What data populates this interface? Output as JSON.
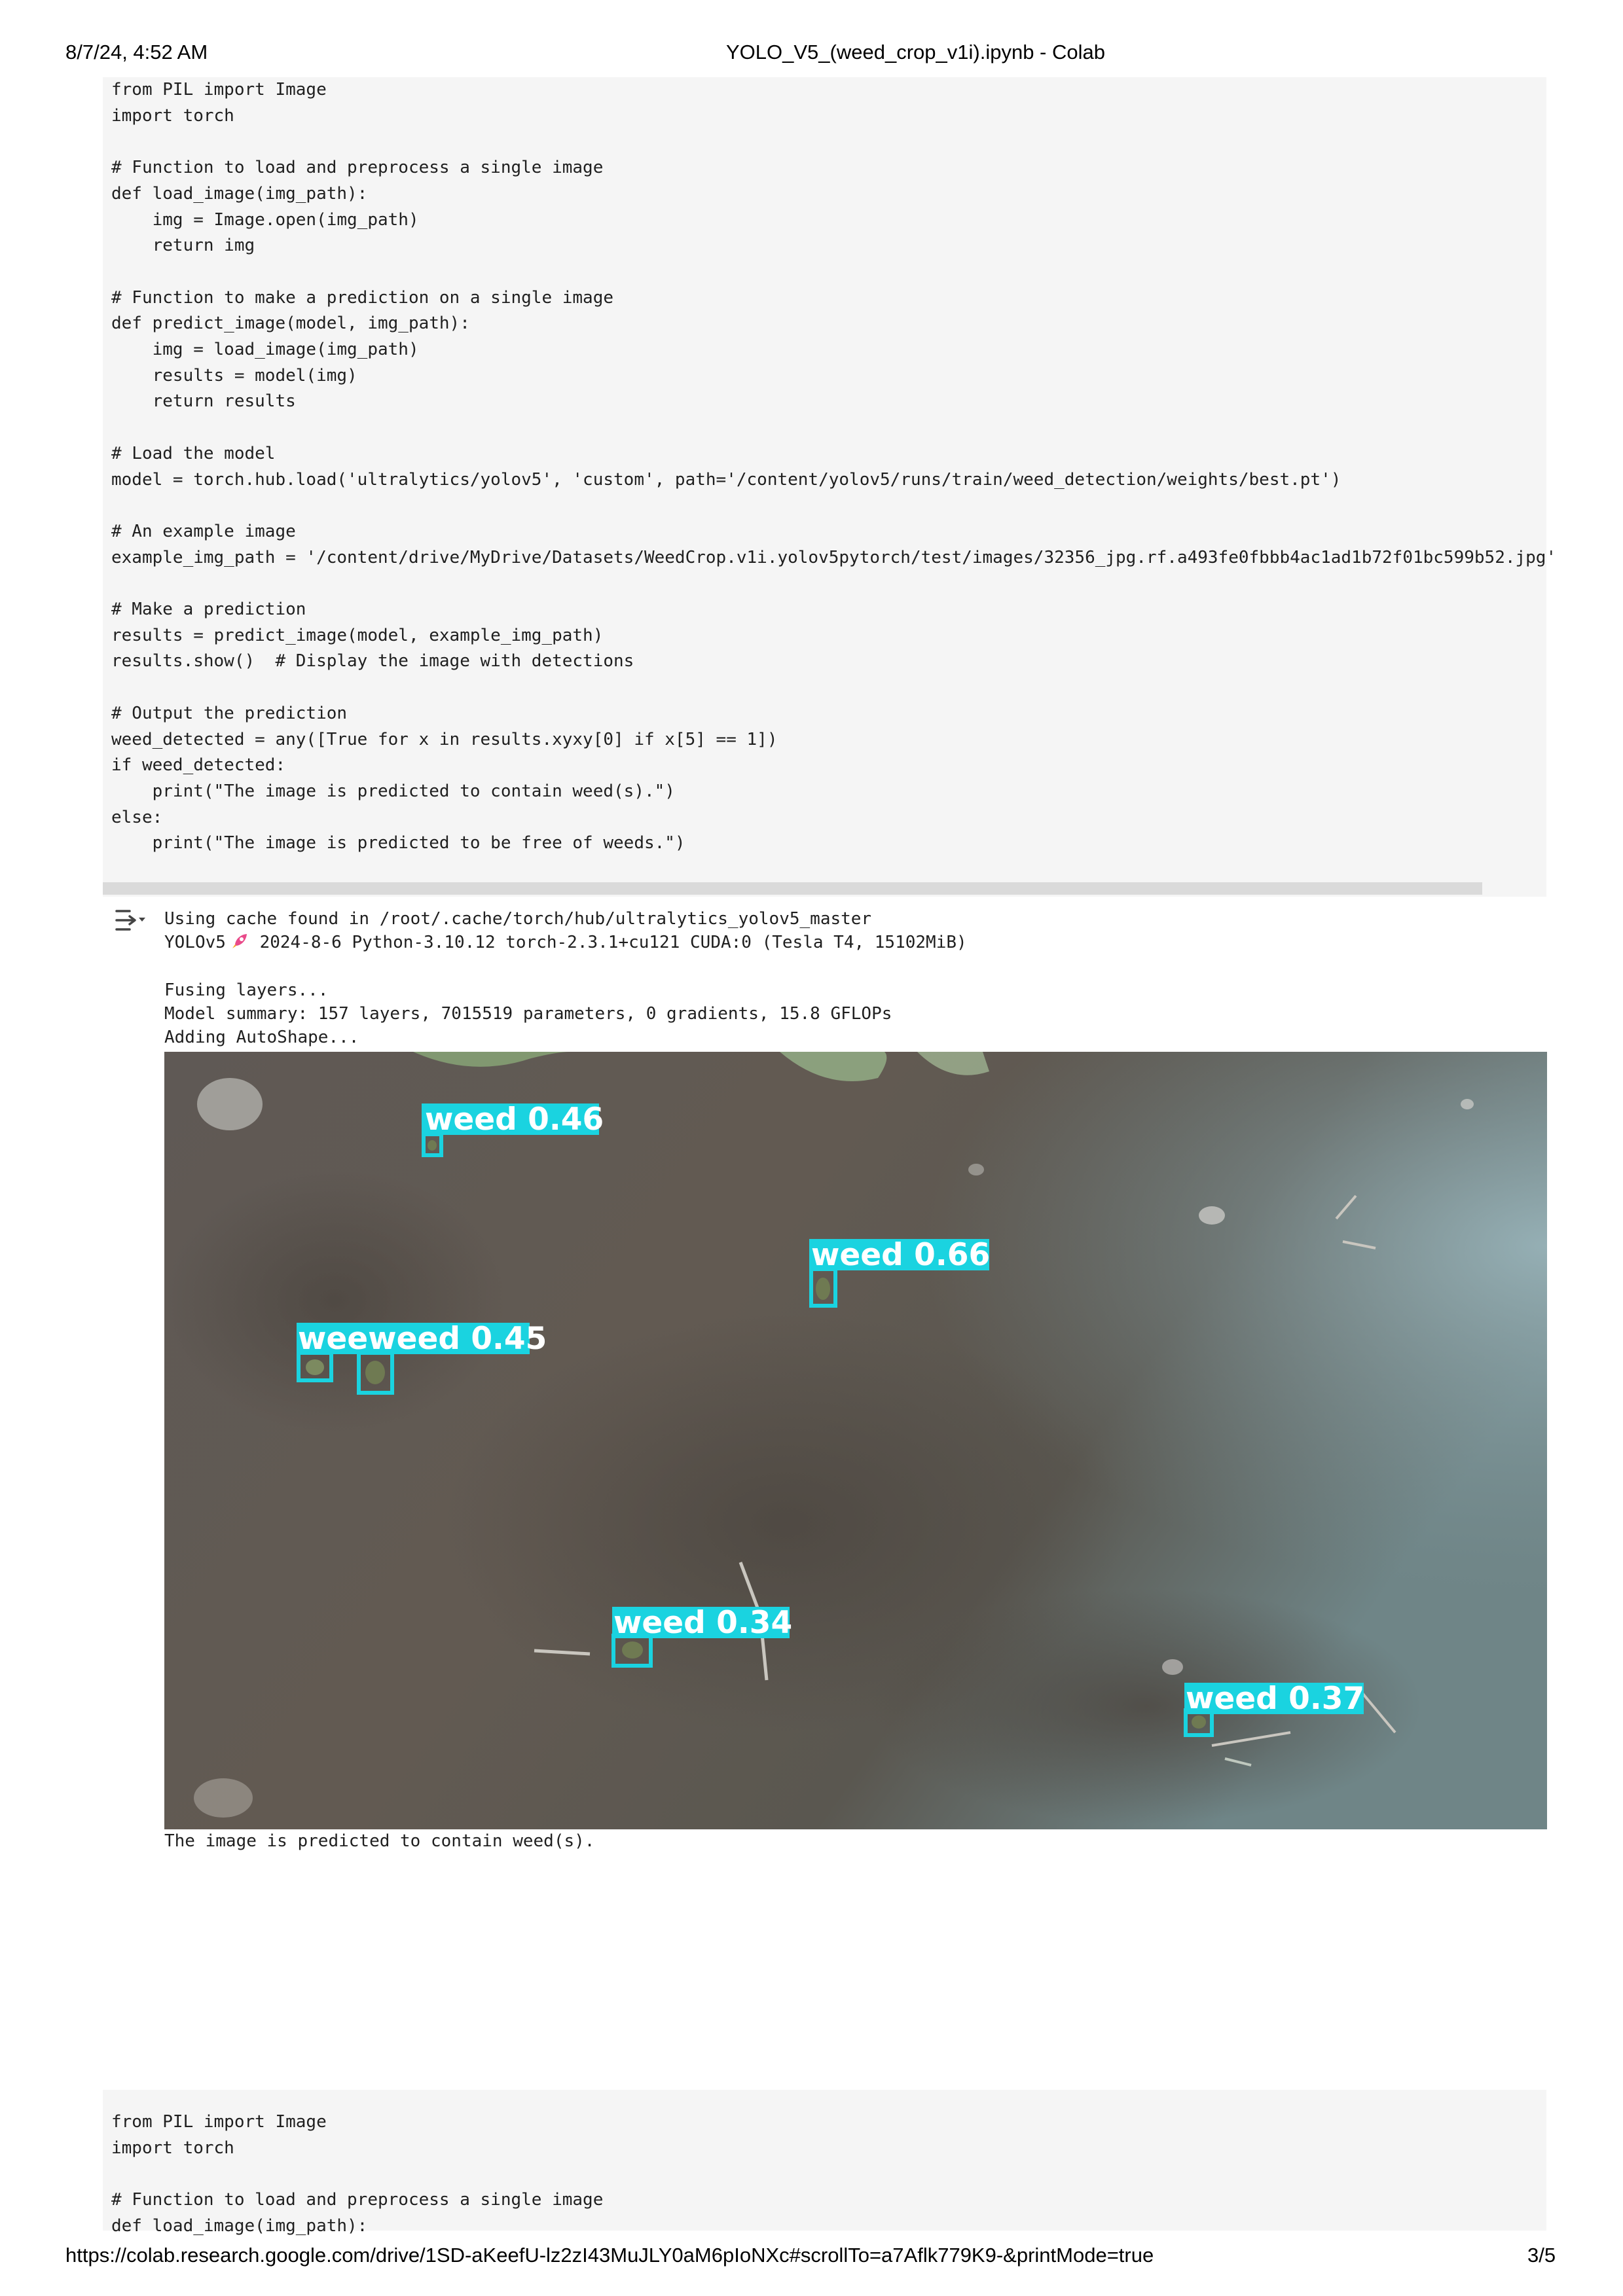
{
  "header": {
    "datetime": "8/7/24, 4:52 AM",
    "title": "YOLO_V5_(weed_crop_v1i).ipynb - Colab"
  },
  "cell1": {
    "code": "from PIL import Image\nimport torch\n\n# Function to load and preprocess a single image\ndef load_image(img_path):\n    img = Image.open(img_path)\n    return img\n\n# Function to make a prediction on a single image\ndef predict_image(model, img_path):\n    img = load_image(img_path)\n    results = model(img)\n    return results\n\n# Load the model\nmodel = torch.hub.load('ultralytics/yolov5', 'custom', path='/content/yolov5/runs/train/weed_detection/weights/best.pt')\n\n# An example image\nexample_img_path = '/content/drive/MyDrive/Datasets/WeedCrop.v1i.yolov5pytorch/test/images/32356_jpg.rf.a493fe0fbbb4ac1ad1b72f01bc599b52.jpg'\n\n# Make a prediction\nresults = predict_image(model, example_img_path)\nresults.show()  # Display the image with detections\n\n# Output the prediction\nweed_detected = any([True for x in results.xyxy[0] if x[5] == 1])\nif weed_detected:\n    print(\"The image is predicted to contain weed(s).\")\nelse:\n    print(\"The image is predicted to be free of weeds.\")"
  },
  "output": {
    "line1": "Using cache found in /root/.cache/torch/hub/ultralytics_yolov5_master",
    "line2_prefix": "YOLOv5",
    "line2_suffix": " 2024-8-6 Python-3.10.12 torch-2.3.1+cu121 CUDA:0 (Tesla T4, 15102MiB)",
    "line3": "Fusing layers...",
    "line4": "Model summary: 157 layers, 7015519 parameters, 0 gradients, 15.8 GFLOPs",
    "line5": "Adding AutoShape...",
    "result_text": "The image is predicted to contain weed(s).",
    "image": {
      "box_color": "#1ad3e0",
      "detections": [
        {
          "label": "weed 0.46"
        },
        {
          "label": "weed 0.66"
        },
        {
          "label": "weeweed 0.45"
        },
        {
          "label": "weed 0.34"
        },
        {
          "label": "weed 0.37"
        }
      ]
    }
  },
  "cell2": {
    "code": "from PIL import Image\nimport torch\n\n# Function to load and preprocess a single image\ndef load_image(img_path):"
  },
  "footer": {
    "url": "https://colab.research.google.com/drive/1SD-aKeefU-lz2zI43MuJLY0aM6pIoNXc#scrollTo=a7Aflk779K9-&printMode=true",
    "page": "3/5"
  }
}
